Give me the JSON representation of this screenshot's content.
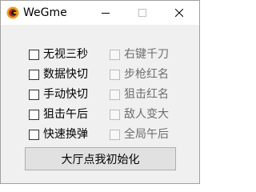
{
  "window": {
    "title": "WeGme",
    "icon": "wegame-logo-icon",
    "controls": {
      "minimize": "minimize-icon",
      "maximize": "maximize-icon",
      "close": "close-icon"
    }
  },
  "options": {
    "left": [
      {
        "label": "无视三秒",
        "checked": false,
        "enabled": true
      },
      {
        "label": "数据快切",
        "checked": false,
        "enabled": true
      },
      {
        "label": "手动快切",
        "checked": false,
        "enabled": true
      },
      {
        "label": "狙击午后",
        "checked": false,
        "enabled": true
      },
      {
        "label": "快速换弹",
        "checked": false,
        "enabled": true
      }
    ],
    "right": [
      {
        "label": "右键千刀",
        "checked": false,
        "enabled": false
      },
      {
        "label": "步枪红名",
        "checked": false,
        "enabled": false
      },
      {
        "label": "狙击红名",
        "checked": false,
        "enabled": false
      },
      {
        "label": "敌人变大",
        "checked": false,
        "enabled": false
      },
      {
        "label": "全局午后",
        "checked": false,
        "enabled": false
      }
    ]
  },
  "main_button": {
    "label": "大厅点我初始化"
  },
  "colors": {
    "logo_outer": "#e8a317",
    "logo_inner": "#c0282d",
    "disabled_text": "#6d6d6d",
    "window_bg": "#f0f0f0"
  }
}
